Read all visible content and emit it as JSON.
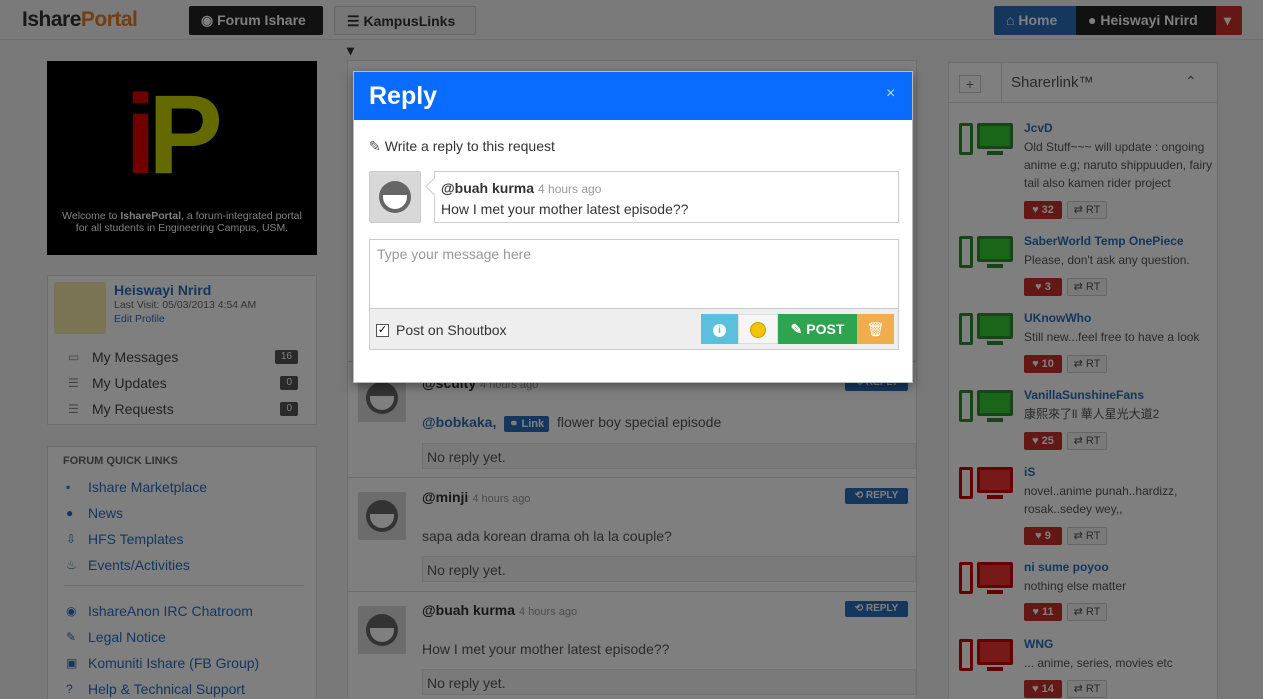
{
  "navbar": {
    "logo_part1": "Ishare",
    "logo_part2": "Portal",
    "forum_label": "Forum Ishare",
    "forum_icon": "rss-icon",
    "kampus_label": "KampusLinks",
    "kampus_icon": "list-icon",
    "home_label": "Home",
    "home_icon": "home-icon",
    "user_label": "Heiswayi Nrird",
    "user_icon": "user-icon",
    "colors": {
      "home": "#2a6ebb",
      "dark": "#222222",
      "danger": "#c9302c"
    }
  },
  "banner": {
    "logo_i": "i",
    "logo_p": "P",
    "welcome_prefix": "Welcome to ",
    "welcome_brand": "IsharePortal",
    "welcome_suffix": ", a forum-integrated portal for all students in Engineering Campus, USM."
  },
  "profile": {
    "name": "Heiswayi Nrird",
    "last_visit": "Last Visit: 05/03/2013 4:54 AM",
    "edit": "Edit Profile",
    "items": [
      {
        "label": "My Messages",
        "count": "16",
        "icon": "comments-icon"
      },
      {
        "label": "My Updates",
        "count": "0",
        "icon": "list-icon"
      },
      {
        "label": "My Requests",
        "count": "0",
        "icon": "list-icon"
      }
    ]
  },
  "quick_links": {
    "title": "FORUM QUICK LINKS",
    "group1": [
      {
        "label": "Ishare Marketplace",
        "icon": "cart-icon"
      },
      {
        "label": "News",
        "icon": "globe-icon"
      },
      {
        "label": "HFS Templates",
        "icon": "download-icon"
      },
      {
        "label": "Events/Activities",
        "icon": "fire-icon"
      }
    ],
    "group2": [
      {
        "label": "IshareAnon IRC Chatroom",
        "icon": "eye-icon"
      },
      {
        "label": "Legal Notice",
        "icon": "gavel-icon"
      },
      {
        "label": "Komuniti Ishare (FB Group)",
        "icon": "facebook-icon"
      },
      {
        "label": "Help & Technical Support",
        "icon": "question-icon"
      }
    ]
  },
  "feed": {
    "reply_label": "REPLY",
    "no_reply": "No reply yet.",
    "link_badge": "Link",
    "items": [
      {
        "user": "@sculty",
        "time": "4 hours ago",
        "mention": "@bobkaka,",
        "msg": "flower boy special episode"
      },
      {
        "user": "@minji",
        "time": "4 hours ago",
        "msg": "sapa ada korean drama oh la la couple?"
      },
      {
        "user": "@buah kurma",
        "time": "4 hours ago",
        "msg": "How I met your mother latest episode??"
      }
    ]
  },
  "sharer": {
    "plus": "+",
    "title": "Sharerlink™",
    "rt_label": "RT",
    "items": [
      {
        "name": "JcvD",
        "desc": "Old Stuff~~~ will update : ongoing anime e.g; naruto shippuuden, fairy tail also kamen rider project",
        "likes": "32",
        "status": "green"
      },
      {
        "name": "SaberWorld Temp OnePiece",
        "desc": "Please, don't ask any question.",
        "likes": "3",
        "status": "green"
      },
      {
        "name": "UKnowWho",
        "desc": "Still new...feel free to have a look",
        "likes": "10",
        "status": "green"
      },
      {
        "name": "VanillaSunshineFans",
        "desc": "康熙來了ll 華人星光大道2",
        "likes": "25",
        "status": "green"
      },
      {
        "name": "iS",
        "desc": "novel..anime punah..hardizz, rosak..sedey wey,,",
        "likes": "9",
        "status": "red"
      },
      {
        "name": "ni sume poyoo",
        "desc": "nothing else matter",
        "likes": "11",
        "status": "red"
      },
      {
        "name": "WNG",
        "desc": "... anime, series, movies etc",
        "likes": "14",
        "status": "red"
      }
    ]
  },
  "modal": {
    "title": "Reply",
    "close": "×",
    "subtitle": "Write a reply to this request",
    "quote_user": "@buah kurma",
    "quote_time": "4 hours ago",
    "quote_msg": "How I met your mother latest episode??",
    "placeholder": "Type your message here",
    "shout_label": "Post on Shoutbox",
    "shout_checked": "✓",
    "post_label": "POST",
    "info_glyph": "i",
    "colors": {
      "header": "#0a6cff",
      "info": "#5bc0de",
      "post": "#2ea44f",
      "trash": "#f0ad4e"
    }
  }
}
